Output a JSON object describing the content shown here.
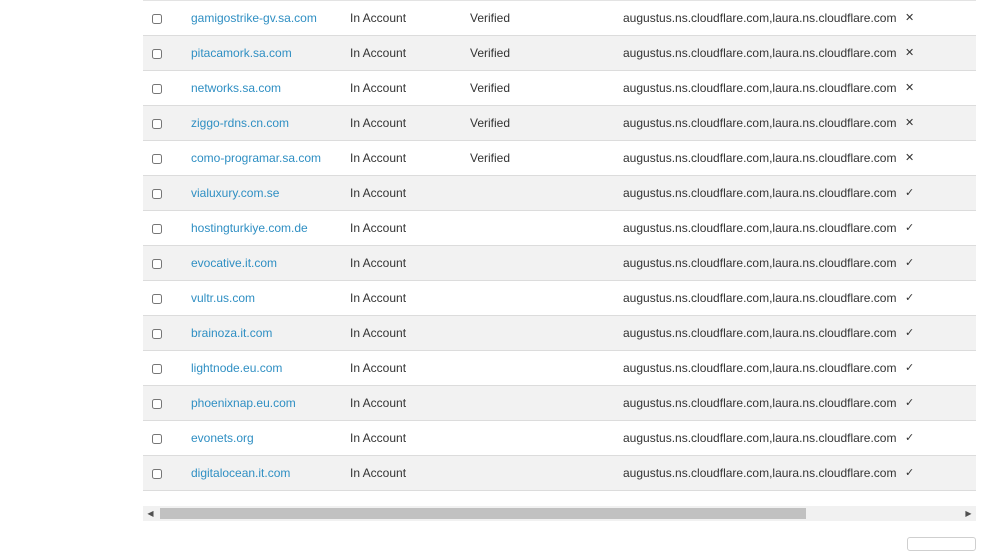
{
  "rows": [
    {
      "domain": "gamigostrike-gv.sa.com",
      "status": "In Account",
      "verification": "Verified",
      "nameservers": "augustus.ns.cloudflare.com,laura.ns.cloudflare.com",
      "mark": "✕"
    },
    {
      "domain": "pitacamork.sa.com",
      "status": "In Account",
      "verification": "Verified",
      "nameservers": "augustus.ns.cloudflare.com,laura.ns.cloudflare.com",
      "mark": "✕"
    },
    {
      "domain": "networks.sa.com",
      "status": "In Account",
      "verification": "Verified",
      "nameservers": "augustus.ns.cloudflare.com,laura.ns.cloudflare.com",
      "mark": "✕"
    },
    {
      "domain": "ziggo-rdns.cn.com",
      "status": "In Account",
      "verification": "Verified",
      "nameservers": "augustus.ns.cloudflare.com,laura.ns.cloudflare.com",
      "mark": "✕"
    },
    {
      "domain": "como-programar.sa.com",
      "status": "In Account",
      "verification": "Verified",
      "nameservers": "augustus.ns.cloudflare.com,laura.ns.cloudflare.com",
      "mark": "✕"
    },
    {
      "domain": "vialuxury.com.se",
      "status": "In Account",
      "verification": "",
      "nameservers": "augustus.ns.cloudflare.com,laura.ns.cloudflare.com",
      "mark": "✓"
    },
    {
      "domain": "hostingturkiye.com.de",
      "status": "In Account",
      "verification": "",
      "nameservers": "augustus.ns.cloudflare.com,laura.ns.cloudflare.com",
      "mark": "✓"
    },
    {
      "domain": "evocative.it.com",
      "status": "In Account",
      "verification": "",
      "nameservers": "augustus.ns.cloudflare.com,laura.ns.cloudflare.com",
      "mark": "✓"
    },
    {
      "domain": "vultr.us.com",
      "status": "In Account",
      "verification": "",
      "nameservers": "augustus.ns.cloudflare.com,laura.ns.cloudflare.com",
      "mark": "✓"
    },
    {
      "domain": "brainoza.it.com",
      "status": "In Account",
      "verification": "",
      "nameservers": "augustus.ns.cloudflare.com,laura.ns.cloudflare.com",
      "mark": "✓"
    },
    {
      "domain": "lightnode.eu.com",
      "status": "In Account",
      "verification": "",
      "nameservers": "augustus.ns.cloudflare.com,laura.ns.cloudflare.com",
      "mark": "✓"
    },
    {
      "domain": "phoenixnap.eu.com",
      "status": "In Account",
      "verification": "",
      "nameservers": "augustus.ns.cloudflare.com,laura.ns.cloudflare.com",
      "mark": "✓"
    },
    {
      "domain": "evonets.org",
      "status": "In Account",
      "verification": "",
      "nameservers": "augustus.ns.cloudflare.com,laura.ns.cloudflare.com",
      "mark": "✓"
    },
    {
      "domain": "digitalocean.it.com",
      "status": "In Account",
      "verification": "",
      "nameservers": "augustus.ns.cloudflare.com,laura.ns.cloudflare.com",
      "mark": "✓"
    }
  ],
  "scrollbar": {
    "left_arrow": "◀",
    "right_arrow": "▶"
  },
  "colors": {
    "link": "#2f8fc3",
    "row_alt": "#f2f2f2",
    "border": "#dcdcdc"
  }
}
